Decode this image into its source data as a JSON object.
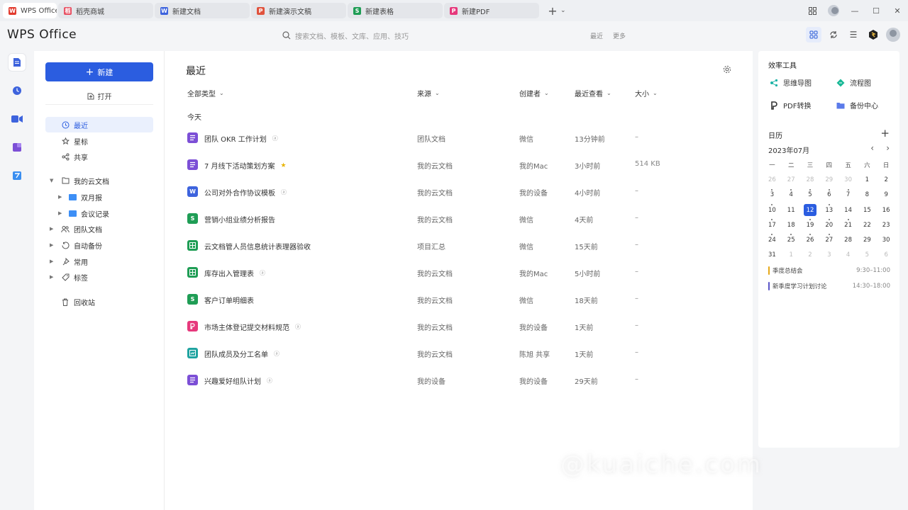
{
  "tabs": [
    {
      "label": "WPS Office",
      "color": "#e23b2e",
      "glyph": "W"
    },
    {
      "label": "稻壳商城",
      "color": "#e84d60",
      "glyph": "稻"
    },
    {
      "label": "新建文档",
      "color": "#3d63dd",
      "glyph": "W"
    },
    {
      "label": "新建演示文稿",
      "color": "#e0533d",
      "glyph": "P"
    },
    {
      "label": "新建表格",
      "color": "#1f9d55",
      "glyph": "S"
    },
    {
      "label": "新建PDF",
      "color": "#e6397c",
      "glyph": "P"
    }
  ],
  "header": {
    "brand": "WPS Office",
    "search_placeholder": "搜索文档、模板、文库、应用、技巧",
    "search_link_1": "最近",
    "search_link_2": "更多"
  },
  "sidebar": {
    "new_label": "新建",
    "open_label": "打开",
    "items": [
      {
        "label": "最近",
        "icon": "clock-icon"
      },
      {
        "label": "星标",
        "icon": "star-icon"
      },
      {
        "label": "共享",
        "icon": "share-icon"
      },
      {
        "label": "我的云文档",
        "icon": "folder-outline-icon"
      },
      {
        "label": "双月报",
        "icon": "folder-icon"
      },
      {
        "label": "会议记录",
        "icon": "folder-icon"
      },
      {
        "label": "团队文档",
        "icon": "team-icon"
      },
      {
        "label": "自动备份",
        "icon": "backup-icon"
      },
      {
        "label": "常用",
        "icon": "pin-icon"
      },
      {
        "label": "标签",
        "icon": "tag-icon"
      },
      {
        "label": "回收站",
        "icon": "trash-icon"
      }
    ]
  },
  "main": {
    "title": "最近",
    "columns": {
      "type": "全部类型",
      "source": "来源",
      "creator": "创建者",
      "viewed": "最近查看",
      "size": "大小"
    },
    "group": "今天",
    "files": [
      {
        "name": "团队 OKR 工作计划",
        "type": "doc",
        "source": "团队文档",
        "creator": "微信",
        "viewed": "13分钟前",
        "size": "–"
      },
      {
        "name": "7 月线下活动策划方案",
        "type": "doc",
        "source": "我的云文档",
        "creator": "我的Mac",
        "viewed": "3小时前",
        "size": "514 KB"
      },
      {
        "name": "公司对外合作协议模板",
        "type": "word",
        "source": "我的云文档",
        "creator": "我的设备",
        "viewed": "4小时前",
        "size": "–"
      },
      {
        "name": "营销小组业绩分析报告",
        "type": "sheet",
        "source": "我的云文档",
        "creator": "微信",
        "viewed": "4天前",
        "size": "–"
      },
      {
        "name": "云文档管人员信息统计表理器验收",
        "type": "table",
        "source": "项目汇总",
        "creator": "微信",
        "viewed": "15天前",
        "size": "–"
      },
      {
        "name": "库存出入管理表",
        "type": "table",
        "source": "我的云文档",
        "creator": "我的Mac",
        "viewed": "5小时前",
        "size": "–"
      },
      {
        "name": "客户订单明细表",
        "type": "sheet",
        "source": "我的云文档",
        "creator": "微信",
        "viewed": "18天前",
        "size": "–"
      },
      {
        "name": "市场主体登记提交材料规范",
        "type": "pdf",
        "source": "我的云文档",
        "creator": "我的设备",
        "viewed": "1天前",
        "size": "–"
      },
      {
        "name": "团队成员及分工名单",
        "type": "form",
        "source": "我的云文档",
        "creator": "陈旭 共享",
        "viewed": "1天前",
        "size": "–"
      },
      {
        "name": "兴趣爱好组队计划",
        "type": "doc",
        "source": "我的设备",
        "creator": "我的设备",
        "viewed": "29天前",
        "size": "–"
      }
    ]
  },
  "right": {
    "tools_title": "效率工具",
    "tools": [
      {
        "label": "思维导图",
        "color": "#1cb3a6"
      },
      {
        "label": "流程图",
        "color": "#18b896"
      },
      {
        "label": "PDF转换",
        "color": "#333333"
      },
      {
        "label": "备份中心",
        "color": "#5b7bea"
      }
    ],
    "calendar_title": "日历",
    "month": "2023年07月",
    "weekdays": [
      "一",
      "二",
      "三",
      "四",
      "五",
      "六",
      "日"
    ],
    "days": [
      {
        "d": "26",
        "dim": true
      },
      {
        "d": "27",
        "dim": true
      },
      {
        "d": "28",
        "dim": true
      },
      {
        "d": "29",
        "dim": true
      },
      {
        "d": "30",
        "dim": true
      },
      {
        "d": "1"
      },
      {
        "d": "2"
      },
      {
        "d": "3",
        "dot": true
      },
      {
        "d": "4",
        "dot": true
      },
      {
        "d": "5",
        "dot": true
      },
      {
        "d": "6",
        "dot": true
      },
      {
        "d": "7",
        "dot": true
      },
      {
        "d": "8"
      },
      {
        "d": "9"
      },
      {
        "d": "10",
        "dot": true
      },
      {
        "d": "11"
      },
      {
        "d": "12",
        "today": true
      },
      {
        "d": "13",
        "dot": true
      },
      {
        "d": "14"
      },
      {
        "d": "15"
      },
      {
        "d": "16"
      },
      {
        "d": "17",
        "dot": true
      },
      {
        "d": "18"
      },
      {
        "d": "19",
        "dot": true
      },
      {
        "d": "20",
        "dot": true
      },
      {
        "d": "21",
        "dot": true
      },
      {
        "d": "22"
      },
      {
        "d": "23"
      },
      {
        "d": "24",
        "dot": true
      },
      {
        "d": "25",
        "dot": true
      },
      {
        "d": "26",
        "dot": true
      },
      {
        "d": "27",
        "dot": true
      },
      {
        "d": "28"
      },
      {
        "d": "29"
      },
      {
        "d": "30"
      },
      {
        "d": "31"
      },
      {
        "d": "1",
        "dim": true
      },
      {
        "d": "2",
        "dim": true
      },
      {
        "d": "3",
        "dim": true
      },
      {
        "d": "4",
        "dim": true
      },
      {
        "d": "5",
        "dim": true
      },
      {
        "d": "6",
        "dim": true
      }
    ],
    "events": [
      {
        "title": "季度总结会",
        "time": "9:30–11:00"
      },
      {
        "title": "新季度学习计划讨论",
        "time": "14:30–18:00"
      }
    ]
  },
  "watermark": "@kuaiche.com",
  "colors": {
    "accent": "#2b5de0",
    "doc": "#7c4fd6",
    "word": "#3d63dd",
    "sheet": "#1f9d55",
    "pdf": "#e6397c",
    "form": "#1fa3a0"
  }
}
